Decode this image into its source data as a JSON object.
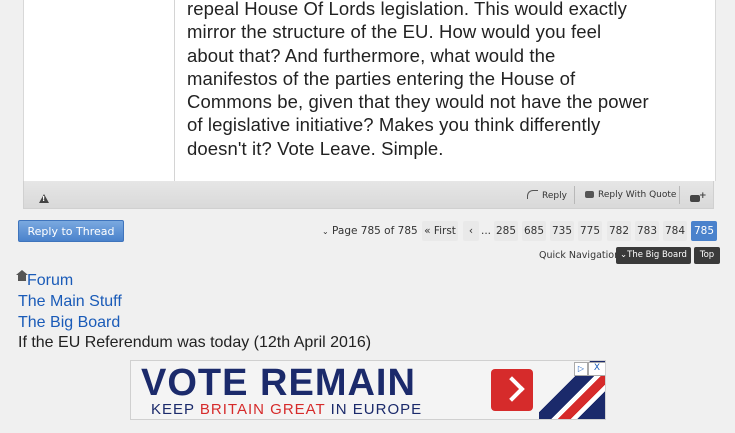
{
  "post": {
    "lines": [
      "repeal House Of Lords legislation. This would exactly",
      "mirror the structure of the EU. How would you feel",
      "about that? And furthermore, what would the",
      "manifestos of the parties entering the House of",
      "Commons be, given that they would not have the power",
      "of legislative initiative? Makes you think differently",
      "doesn't it? Vote Leave. Simple."
    ],
    "footer": {
      "reply_label": "Reply",
      "reply_with_quote_label": "Reply With Quote"
    }
  },
  "reply_to_thread_label": "Reply to Thread",
  "pagination": {
    "page_text": "Page 785 of 785",
    "first_label": "« First",
    "prev_label": "‹",
    "ellipsis": "...",
    "pages": [
      "285",
      "685",
      "735",
      "775",
      "782",
      "783",
      "784",
      "785"
    ],
    "current": "785"
  },
  "quick_navigation": {
    "label": "Quick Navigation",
    "forum_button": "The Big Board",
    "top_button": "Top"
  },
  "breadcrumb": {
    "forum": "Forum",
    "section": "The Main Stuff",
    "board": "The Big Board",
    "thread_title": "If the EU Referendum was today (12th April 2016)"
  },
  "ad": {
    "headline_1": "VOTE ",
    "headline_2": "REMAIN",
    "subline_1": "KEEP ",
    "subline_2": "BRITAIN GREAT",
    "subline_3": " IN EUROPE",
    "close_label": "X",
    "info_label": "▷"
  },
  "colors": {
    "link": "#1a5bb8",
    "button_blue": "#4a82cc",
    "ad_navy": "#1b2a6b",
    "ad_red": "#d62b2b"
  }
}
